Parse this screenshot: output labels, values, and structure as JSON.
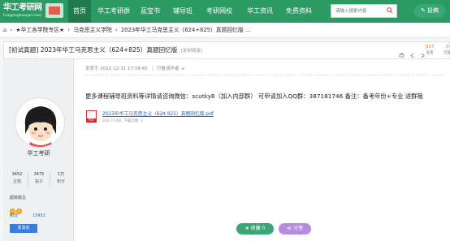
{
  "brand": {
    "name": "华工考研网",
    "domain": "huagongkaoyan.com"
  },
  "nav": {
    "items": [
      {
        "label": "首页",
        "active": true
      },
      {
        "label": "华工考研群"
      },
      {
        "label": "蓝宝书"
      },
      {
        "label": "辅导班"
      },
      {
        "label": "考研网校"
      },
      {
        "label": "华工资讯"
      },
      {
        "label": "免费资料"
      }
    ],
    "search_placeholder": "请输入搜索内容",
    "post_label": "投稿"
  },
  "breadcrumb": {
    "items": [
      "★华工各学院专区★",
      "马克思主义学院",
      "2023年华工马克思主义（624+825）真题回忆版 ..."
    ]
  },
  "thread": {
    "tag": "[初试真题]",
    "title": "2023年华工马克思主义（624+825）真题回忆版",
    "copy_link": "[复制链接]",
    "views": "917",
    "views_label": "查看",
    "replies": "0",
    "replies_label": "回复"
  },
  "author": {
    "name": "华工考研",
    "stats": [
      {
        "value": "3452",
        "label": "主题"
      },
      {
        "value": "3475",
        "label": "帖子"
      },
      {
        "value": "1万",
        "label": "积分"
      }
    ],
    "level": "超级版主",
    "points_label": "积分",
    "points": "15452",
    "message_label": "发消息"
  },
  "post": {
    "meta_prefix": "发表于",
    "timestamp": "2022-12-31 17:58:45",
    "author_only": "只看该作者",
    "body": "更多课程辅导班资料等详情请咨询微信：scutky8（加入内部群） 可申请加入QQ群：387181746 备注：备考年份+专业 进群哦",
    "attachment": {
      "name": "2023年华工马克思主义（624 825）真题回忆版.pdf",
      "info": "203.73 KB, 下载次数: 3"
    },
    "favorite_label": "收藏",
    "favorite_count": "0",
    "share_label": "分享"
  },
  "colors": {
    "nav_bg": "#2b9b63",
    "nav_active": "#1f7a4d",
    "link": "#1b65b8",
    "share": "#b68be0"
  }
}
